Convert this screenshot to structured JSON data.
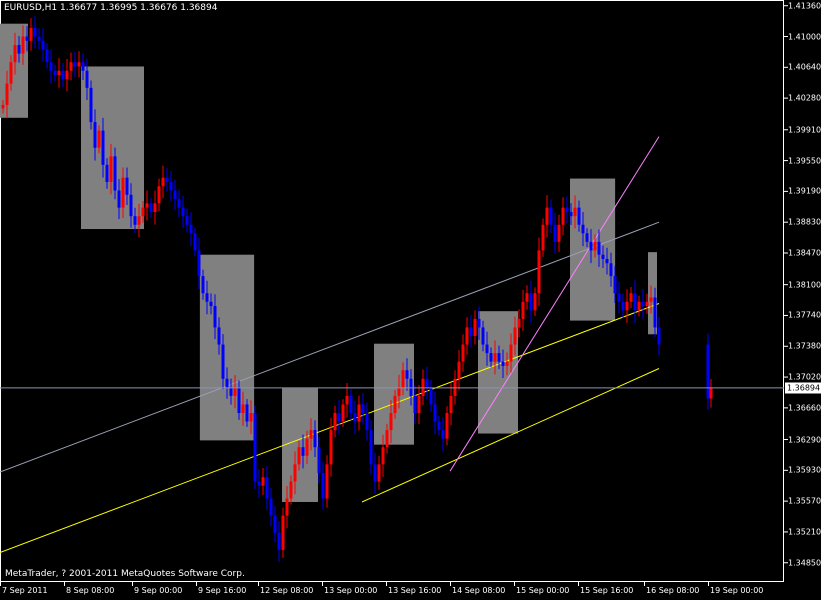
{
  "window": {
    "title_symbol": "EURUSD,H1",
    "title_ohlc": "1.36677 1.36995 1.36676 1.36894",
    "copyright": "MetaTrader, ? 2001-2011 MetaQuotes Software Corp."
  },
  "chart_data": {
    "type": "candlestick",
    "symbol": "EURUSD",
    "timeframe": "H1",
    "ylim": [
      1.3466,
      1.4138
    ],
    "y_ticks": [
      "1.41360",
      "1.41000",
      "1.40640",
      "1.40280",
      "1.39910",
      "1.39550",
      "1.39190",
      "1.38830",
      "1.38470",
      "1.38100",
      "1.37740",
      "1.37380",
      "1.37020",
      "1.36660",
      "1.36290",
      "1.35930",
      "1.35570",
      "1.35210",
      "1.34850"
    ],
    "x_ticks": [
      "7 Sep 2011",
      "8 Sep 08:00",
      "9 Sep 00:00",
      "9 Sep 16:00",
      "12 Sep 08:00",
      "13 Sep 00:00",
      "13 Sep 16:00",
      "14 Sep 08:00",
      "15 Sep 00:00",
      "15 Sep 16:00",
      "16 Sep 08:00",
      "19 Sep 00:00"
    ],
    "current_price": "1.36894",
    "bull_color": "#ff0000",
    "bear_color": "#0000ff",
    "shaded_boxes": [
      {
        "x_start": "7 Sep 2011",
        "x_end": "7 Sep 14:00",
        "y_low": 1.4005,
        "y_high": 1.4115
      },
      {
        "x_start": "8 Sep 12:00",
        "x_end": "9 Sep 03:00",
        "y_low": 1.3875,
        "y_high": 1.4065
      },
      {
        "x_start": "9 Sep 20:00",
        "x_end": "12 Sep 04:00",
        "y_low": 1.3628,
        "y_high": 1.3845
      },
      {
        "x_start": "12 Sep 14:00",
        "x_end": "12 Sep 23:00",
        "y_low": 1.3556,
        "y_high": 1.3689
      },
      {
        "x_start": "13 Sep 13:00",
        "x_end": "13 Sep 23:00",
        "y_low": 1.3623,
        "y_high": 1.3741
      },
      {
        "x_start": "14 Sep 15:00",
        "x_end": "15 Sep 01:00",
        "y_low": 1.3636,
        "y_high": 1.3779
      },
      {
        "x_start": "15 Sep 14:00",
        "x_end": "16 Sep 01:00",
        "y_low": 1.3768,
        "y_high": 1.3934
      },
      {
        "x_start": "16 Sep 12:00",
        "x_end": "16 Sep 21:00",
        "y_low": 1.3752,
        "y_high": 1.3848
      }
    ],
    "trendlines": [
      {
        "color": "#ffff00",
        "from": [
          "7 Sep 2011",
          1.3497
        ],
        "to": [
          "16 Sep 23:00",
          1.3788
        ]
      },
      {
        "color": "#ffff00",
        "from": [
          "13 Sep 10:00",
          1.3556
        ],
        "to": [
          "16 Sep 23:00",
          1.3712
        ]
      },
      {
        "color": "#9aa0b4",
        "from": [
          "7 Sep 2011",
          1.3591
        ],
        "to": [
          "16 Sep 23:00",
          1.3883
        ]
      },
      {
        "color": "#ff80ff",
        "from": [
          "14 Sep 08:00",
          1.3592
        ],
        "to": [
          "16 Sep 23:00",
          1.3983
        ]
      }
    ],
    "closes": [
      1.402,
      1.4045,
      1.407,
      1.409,
      1.408,
      1.41,
      1.4095,
      1.411,
      1.41,
      1.4095,
      1.4085,
      1.407,
      1.406,
      1.4055,
      1.406,
      1.405,
      1.406,
      1.407,
      1.4065,
      1.407,
      1.406,
      1.404,
      1.4,
      1.397,
      1.399,
      1.395,
      1.393,
      1.396,
      1.392,
      1.39,
      1.3935,
      1.3915,
      1.389,
      1.388,
      1.389,
      1.39,
      1.3905,
      1.3895,
      1.3905,
      1.3925,
      1.3935,
      1.393,
      1.392,
      1.391,
      1.39,
      1.389,
      1.388,
      1.387,
      1.385,
      1.382,
      1.38,
      1.379,
      1.3785,
      1.376,
      1.374,
      1.37,
      1.369,
      1.368,
      1.369,
      1.366,
      1.367,
      1.365,
      1.366,
      1.358,
      1.3575,
      1.3585,
      1.356,
      1.354,
      1.352,
      1.35,
      1.354,
      1.356,
      1.358,
      1.36,
      1.362,
      1.361,
      1.363,
      1.364,
      1.362,
      1.359,
      1.356,
      1.36,
      1.364,
      1.366,
      1.365,
      1.367,
      1.368,
      1.366,
      1.365,
      1.367,
      1.366,
      1.364,
      1.36,
      1.358,
      1.36,
      1.362,
      1.364,
      1.366,
      1.368,
      1.369,
      1.371,
      1.37,
      1.368,
      1.366,
      1.368,
      1.37,
      1.369,
      1.367,
      1.365,
      1.364,
      1.363,
      1.366,
      1.368,
      1.37,
      1.372,
      1.374,
      1.376,
      1.375,
      1.377,
      1.376,
      1.374,
      1.373,
      1.372,
      1.373,
      1.372,
      1.3715,
      1.372,
      1.374,
      1.376,
      1.377,
      1.379,
      1.38,
      1.378,
      1.38,
      1.385,
      1.388,
      1.39,
      1.388,
      1.386,
      1.388,
      1.39,
      1.3895,
      1.389,
      1.39,
      1.388,
      1.387,
      1.386,
      1.385,
      1.386,
      1.3845,
      1.384,
      1.3835,
      1.382,
      1.38,
      1.379,
      1.378,
      1.379,
      1.38,
      1.378,
      1.379,
      1.3785,
      1.379,
      1.3795,
      1.376,
      1.374,
      1.3677,
      1.3689
    ]
  }
}
